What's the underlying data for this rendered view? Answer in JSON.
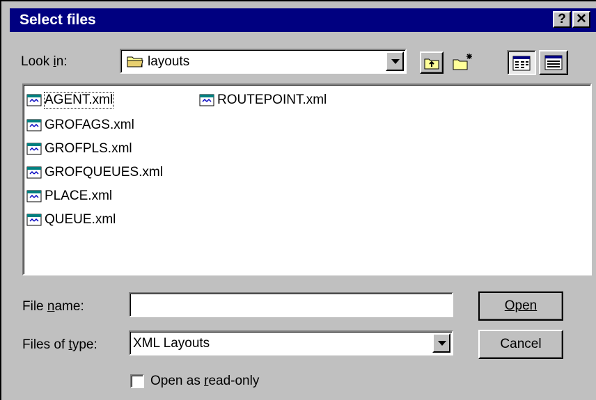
{
  "window": {
    "title": "Select files",
    "help_label": "?",
    "close_label": "✕"
  },
  "lookin": {
    "label": "Look in:",
    "value": "layouts"
  },
  "toolbar": {
    "up_folder_icon": "up-folder-icon",
    "new_folder_icon": "new-folder-icon",
    "list_view_icon": "list-view-icon",
    "details_view_icon": "details-view-icon"
  },
  "files": [
    {
      "name": "AGENT.xml",
      "selected": true
    },
    {
      "name": "GROFAGS.xml"
    },
    {
      "name": "GROFPLS.xml"
    },
    {
      "name": "GROFQUEUES.xml"
    },
    {
      "name": "PLACE.xml"
    },
    {
      "name": "QUEUE.xml"
    },
    {
      "name": "ROUTEPOINT.xml"
    }
  ],
  "filename": {
    "label": "File name:",
    "value": ""
  },
  "filetype": {
    "label": "Files of type:",
    "value": "XML Layouts"
  },
  "buttons": {
    "open": "Open",
    "cancel": "Cancel"
  },
  "readonly": {
    "label": "Open as read-only",
    "checked": false
  },
  "colors": {
    "titlebar": "#000080",
    "face": "#c0c0c0"
  }
}
